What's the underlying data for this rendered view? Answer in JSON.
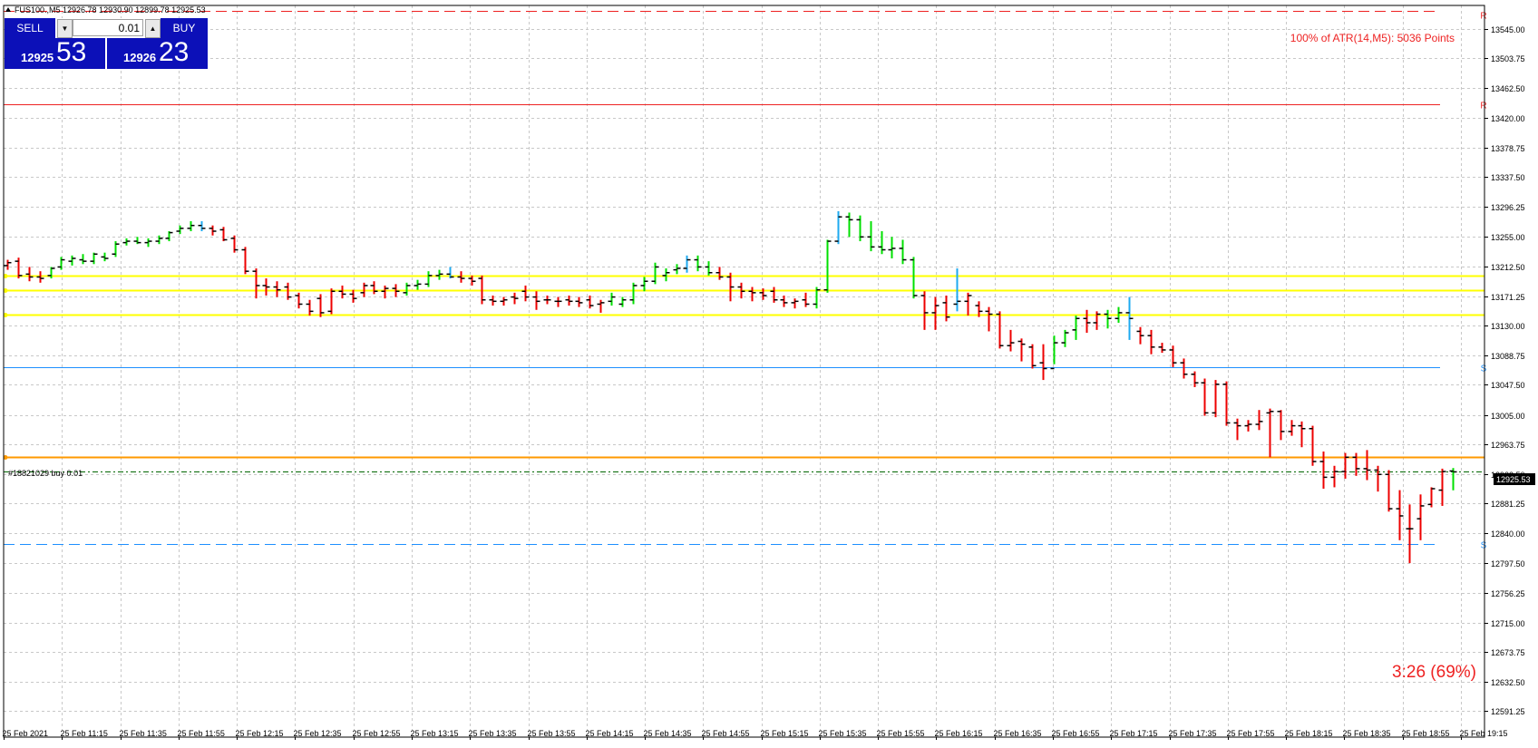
{
  "window": {
    "title": "FUS100.,M5  12926.78 12930.90 12899.78 12925.53",
    "symbol": "FUS100.",
    "timeframe": "M5",
    "ohlc": [
      "12926.78",
      "12930.90",
      "12899.78",
      "12925.53"
    ]
  },
  "trade_panel": {
    "sell_label": "SELL",
    "buy_label": "BUY",
    "lot_value": "0.01",
    "sell_price_small": "12925",
    "sell_price_big": "53",
    "buy_price_small": "12926",
    "buy_price_big": "23",
    "icons": [
      "arrow-down-icon",
      "arrow-up-icon"
    ]
  },
  "indicator_text": {
    "atr": "100% of ATR(14,M5): 5036  Points",
    "timer": "3:26 (69%)"
  },
  "order_label": "#18821029 buy 0.01",
  "current_price_label": "12925.53",
  "line_markers": {
    "resistance": "R",
    "support": "S"
  },
  "colors": {
    "bull": "#00e000",
    "bear": "#ee0000",
    "special": "#1eaaf0",
    "resistance": "#ee2222",
    "support": "#1e90ff",
    "zone": "#ffff00",
    "order": "#ff9900",
    "bid": "#006600",
    "text_red": "#ee2222",
    "grid": "#c8c8c8"
  },
  "chart_data": {
    "type": "ohlc-bar",
    "y_ticks": [
      "13545.00",
      "13503.75",
      "13462.50",
      "13420.00",
      "13378.75",
      "13337.50",
      "13296.25",
      "13255.00",
      "13212.50",
      "13171.25",
      "13130.00",
      "13088.75",
      "13047.50",
      "13005.00",
      "12963.75",
      "12922.50",
      "12881.25",
      "12840.00",
      "12797.50",
      "12756.25",
      "12715.00",
      "12673.75",
      "12632.50",
      "12591.25"
    ],
    "x_labels": [
      "25 Feb 2021",
      "25 Feb 11:15",
      "25 Feb 11:35",
      "25 Feb 11:55",
      "25 Feb 12:15",
      "25 Feb 12:35",
      "25 Feb 12:55",
      "25 Feb 13:15",
      "25 Feb 13:35",
      "25 Feb 13:55",
      "25 Feb 14:15",
      "25 Feb 14:35",
      "25 Feb 14:55",
      "25 Feb 15:15",
      "25 Feb 15:35",
      "25 Feb 15:55",
      "25 Feb 16:15",
      "25 Feb 16:35",
      "25 Feb 16:55",
      "25 Feb 17:15",
      "25 Feb 17:35",
      "25 Feb 17:55",
      "25 Feb 18:15",
      "25 Feb 18:35",
      "25 Feb 18:55",
      "25 Feb 19:15"
    ],
    "ylim": [
      12575,
      13570
    ],
    "levels": [
      {
        "kind": "resistance",
        "price": 13570,
        "style": "dashed"
      },
      {
        "kind": "resistance",
        "price": 13440,
        "style": "solid"
      },
      {
        "kind": "zone",
        "price": 13200,
        "style": "solid"
      },
      {
        "kind": "zone",
        "price": 13180,
        "style": "solid"
      },
      {
        "kind": "zone",
        "price": 13145,
        "style": "solid"
      },
      {
        "kind": "support",
        "price": 13072,
        "style": "solid"
      },
      {
        "kind": "order",
        "price": 12946,
        "style": "solid"
      },
      {
        "kind": "bid",
        "price": 12925.53,
        "style": "dashdot"
      },
      {
        "kind": "support",
        "price": 12825,
        "style": "dashed"
      }
    ],
    "bars": [
      {
        "o": 13214,
        "h": 13222,
        "l": 13208,
        "c": 13218,
        "d": "bear"
      },
      {
        "o": 13220,
        "h": 13225,
        "l": 13196,
        "c": 13200,
        "d": "bear"
      },
      {
        "o": 13202,
        "h": 13212,
        "l": 13192,
        "c": 13198,
        "d": "bear"
      },
      {
        "o": 13198,
        "h": 13206,
        "l": 13190,
        "c": 13196,
        "d": "bear"
      },
      {
        "o": 13200,
        "h": 13212,
        "l": 13196,
        "c": 13210,
        "d": "bull"
      },
      {
        "o": 13212,
        "h": 13226,
        "l": 13208,
        "c": 13222,
        "d": "bull"
      },
      {
        "o": 13220,
        "h": 13228,
        "l": 13214,
        "c": 13224,
        "d": "bull"
      },
      {
        "o": 13222,
        "h": 13230,
        "l": 13216,
        "c": 13220,
        "d": "bull"
      },
      {
        "o": 13220,
        "h": 13232,
        "l": 13216,
        "c": 13230,
        "d": "bull"
      },
      {
        "o": 13226,
        "h": 13232,
        "l": 13220,
        "c": 13224,
        "d": "bull"
      },
      {
        "o": 13230,
        "h": 13248,
        "l": 13226,
        "c": 13244,
        "d": "bull"
      },
      {
        "o": 13246,
        "h": 13252,
        "l": 13242,
        "c": 13248,
        "d": "bull"
      },
      {
        "o": 13248,
        "h": 13254,
        "l": 13244,
        "c": 13246,
        "d": "bull"
      },
      {
        "o": 13246,
        "h": 13252,
        "l": 13240,
        "c": 13248,
        "d": "bull"
      },
      {
        "o": 13248,
        "h": 13256,
        "l": 13244,
        "c": 13252,
        "d": "bull"
      },
      {
        "o": 13252,
        "h": 13262,
        "l": 13248,
        "c": 13260,
        "d": "bull"
      },
      {
        "o": 13262,
        "h": 13270,
        "l": 13258,
        "c": 13266,
        "d": "bull"
      },
      {
        "o": 13266,
        "h": 13276,
        "l": 13262,
        "c": 13270,
        "d": "bull"
      },
      {
        "o": 13270,
        "h": 13276,
        "l": 13262,
        "c": 13266,
        "d": "special"
      },
      {
        "o": 13266,
        "h": 13270,
        "l": 13256,
        "c": 13262,
        "d": "bear"
      },
      {
        "o": 13264,
        "h": 13268,
        "l": 13248,
        "c": 13250,
        "d": "bear"
      },
      {
        "o": 13252,
        "h": 13256,
        "l": 13232,
        "c": 13236,
        "d": "bear"
      },
      {
        "o": 13236,
        "h": 13240,
        "l": 13202,
        "c": 13206,
        "d": "bear"
      },
      {
        "o": 13206,
        "h": 13210,
        "l": 13168,
        "c": 13186,
        "d": "bear"
      },
      {
        "o": 13186,
        "h": 13196,
        "l": 13172,
        "c": 13184,
        "d": "bear"
      },
      {
        "o": 13184,
        "h": 13192,
        "l": 13170,
        "c": 13180,
        "d": "bear"
      },
      {
        "o": 13184,
        "h": 13190,
        "l": 13166,
        "c": 13170,
        "d": "bear"
      },
      {
        "o": 13172,
        "h": 13176,
        "l": 13154,
        "c": 13160,
        "d": "bear"
      },
      {
        "o": 13160,
        "h": 13166,
        "l": 13144,
        "c": 13150,
        "d": "bear"
      },
      {
        "o": 13168,
        "h": 13174,
        "l": 13142,
        "c": 13148,
        "d": "bear"
      },
      {
        "o": 13150,
        "h": 13182,
        "l": 13146,
        "c": 13178,
        "d": "bear"
      },
      {
        "o": 13178,
        "h": 13186,
        "l": 13168,
        "c": 13174,
        "d": "bear"
      },
      {
        "o": 13174,
        "h": 13180,
        "l": 13162,
        "c": 13168,
        "d": "bear"
      },
      {
        "o": 13176,
        "h": 13190,
        "l": 13170,
        "c": 13186,
        "d": "bear"
      },
      {
        "o": 13186,
        "h": 13192,
        "l": 13174,
        "c": 13178,
        "d": "bear"
      },
      {
        "o": 13178,
        "h": 13186,
        "l": 13168,
        "c": 13182,
        "d": "bear"
      },
      {
        "o": 13182,
        "h": 13188,
        "l": 13170,
        "c": 13178,
        "d": "bear"
      },
      {
        "o": 13176,
        "h": 13190,
        "l": 13172,
        "c": 13186,
        "d": "bull"
      },
      {
        "o": 13186,
        "h": 13194,
        "l": 13180,
        "c": 13188,
        "d": "bull"
      },
      {
        "o": 13188,
        "h": 13206,
        "l": 13184,
        "c": 13200,
        "d": "bull"
      },
      {
        "o": 13200,
        "h": 13208,
        "l": 13194,
        "c": 13202,
        "d": "bull"
      },
      {
        "o": 13202,
        "h": 13212,
        "l": 13196,
        "c": 13198,
        "d": "special"
      },
      {
        "o": 13198,
        "h": 13206,
        "l": 13190,
        "c": 13196,
        "d": "bear"
      },
      {
        "o": 13196,
        "h": 13200,
        "l": 13186,
        "c": 13192,
        "d": "bear"
      },
      {
        "o": 13196,
        "h": 13200,
        "l": 13160,
        "c": 13166,
        "d": "bear"
      },
      {
        "o": 13166,
        "h": 13172,
        "l": 13158,
        "c": 13164,
        "d": "bear"
      },
      {
        "o": 13164,
        "h": 13170,
        "l": 13158,
        "c": 13166,
        "d": "bear"
      },
      {
        "o": 13170,
        "h": 13176,
        "l": 13160,
        "c": 13168,
        "d": "bear"
      },
      {
        "o": 13178,
        "h": 13186,
        "l": 13164,
        "c": 13170,
        "d": "bear"
      },
      {
        "o": 13170,
        "h": 13178,
        "l": 13152,
        "c": 13164,
        "d": "bear"
      },
      {
        "o": 13166,
        "h": 13172,
        "l": 13160,
        "c": 13166,
        "d": "bear"
      },
      {
        "o": 13164,
        "h": 13170,
        "l": 13156,
        "c": 13164,
        "d": "bear"
      },
      {
        "o": 13166,
        "h": 13172,
        "l": 13158,
        "c": 13164,
        "d": "bear"
      },
      {
        "o": 13164,
        "h": 13170,
        "l": 13156,
        "c": 13162,
        "d": "bear"
      },
      {
        "o": 13166,
        "h": 13172,
        "l": 13154,
        "c": 13158,
        "d": "bear"
      },
      {
        "o": 13160,
        "h": 13166,
        "l": 13148,
        "c": 13162,
        "d": "bear"
      },
      {
        "o": 13164,
        "h": 13176,
        "l": 13158,
        "c": 13170,
        "d": "bull"
      },
      {
        "o": 13160,
        "h": 13170,
        "l": 13156,
        "c": 13166,
        "d": "bull"
      },
      {
        "o": 13166,
        "h": 13190,
        "l": 13160,
        "c": 13186,
        "d": "bull"
      },
      {
        "o": 13186,
        "h": 13198,
        "l": 13178,
        "c": 13192,
        "d": "bull"
      },
      {
        "o": 13192,
        "h": 13218,
        "l": 13188,
        "c": 13212,
        "d": "bull"
      },
      {
        "o": 13200,
        "h": 13210,
        "l": 13192,
        "c": 13204,
        "d": "bull"
      },
      {
        "o": 13208,
        "h": 13216,
        "l": 13202,
        "c": 13210,
        "d": "bull"
      },
      {
        "o": 13210,
        "h": 13228,
        "l": 13204,
        "c": 13222,
        "d": "special"
      },
      {
        "o": 13222,
        "h": 13228,
        "l": 13206,
        "c": 13212,
        "d": "bull"
      },
      {
        "o": 13212,
        "h": 13220,
        "l": 13200,
        "c": 13204,
        "d": "bull"
      },
      {
        "o": 13204,
        "h": 13212,
        "l": 13194,
        "c": 13198,
        "d": "bear"
      },
      {
        "o": 13198,
        "h": 13204,
        "l": 13164,
        "c": 13184,
        "d": "bear"
      },
      {
        "o": 13184,
        "h": 13190,
        "l": 13168,
        "c": 13178,
        "d": "bear"
      },
      {
        "o": 13178,
        "h": 13184,
        "l": 13164,
        "c": 13176,
        "d": "bear"
      },
      {
        "o": 13176,
        "h": 13182,
        "l": 13166,
        "c": 13172,
        "d": "bear"
      },
      {
        "o": 13178,
        "h": 13184,
        "l": 13162,
        "c": 13166,
        "d": "bear"
      },
      {
        "o": 13166,
        "h": 13172,
        "l": 13156,
        "c": 13162,
        "d": "bear"
      },
      {
        "o": 13162,
        "h": 13168,
        "l": 13154,
        "c": 13164,
        "d": "bear"
      },
      {
        "o": 13166,
        "h": 13176,
        "l": 13156,
        "c": 13160,
        "d": "bear"
      },
      {
        "o": 13160,
        "h": 13184,
        "l": 13154,
        "c": 13180,
        "d": "bull"
      },
      {
        "o": 13180,
        "h": 13250,
        "l": 13176,
        "c": 13248,
        "d": "bull"
      },
      {
        "o": 13248,
        "h": 13290,
        "l": 13244,
        "c": 13282,
        "d": "special"
      },
      {
        "o": 13282,
        "h": 13288,
        "l": 13254,
        "c": 13278,
        "d": "bull"
      },
      {
        "o": 13278,
        "h": 13284,
        "l": 13248,
        "c": 13254,
        "d": "bull"
      },
      {
        "o": 13254,
        "h": 13276,
        "l": 13234,
        "c": 13240,
        "d": "bull"
      },
      {
        "o": 13240,
        "h": 13262,
        "l": 13230,
        "c": 13236,
        "d": "bull"
      },
      {
        "o": 13236,
        "h": 13254,
        "l": 13224,
        "c": 13238,
        "d": "bull"
      },
      {
        "o": 13238,
        "h": 13250,
        "l": 13216,
        "c": 13222,
        "d": "bull"
      },
      {
        "o": 13222,
        "h": 13226,
        "l": 13168,
        "c": 13172,
        "d": "bull"
      },
      {
        "o": 13172,
        "h": 13178,
        "l": 13124,
        "c": 13148,
        "d": "bear"
      },
      {
        "o": 13148,
        "h": 13170,
        "l": 13124,
        "c": 13158,
        "d": "bear"
      },
      {
        "o": 13162,
        "h": 13172,
        "l": 13136,
        "c": 13142,
        "d": "bear"
      },
      {
        "o": 13160,
        "h": 13210,
        "l": 13150,
        "c": 13164,
        "d": "special"
      },
      {
        "o": 13164,
        "h": 13176,
        "l": 13144,
        "c": 13172,
        "d": "bear"
      },
      {
        "o": 13158,
        "h": 13164,
        "l": 13142,
        "c": 13150,
        "d": "bear"
      },
      {
        "o": 13150,
        "h": 13156,
        "l": 13122,
        "c": 13146,
        "d": "bear"
      },
      {
        "o": 13146,
        "h": 13150,
        "l": 13098,
        "c": 13102,
        "d": "bear"
      },
      {
        "o": 13102,
        "h": 13124,
        "l": 13094,
        "c": 13106,
        "d": "bear"
      },
      {
        "o": 13108,
        "h": 13112,
        "l": 13080,
        "c": 13104,
        "d": "bear"
      },
      {
        "o": 13100,
        "h": 13104,
        "l": 13070,
        "c": 13074,
        "d": "bear"
      },
      {
        "o": 13078,
        "h": 13104,
        "l": 13054,
        "c": 13070,
        "d": "bear"
      },
      {
        "o": 13070,
        "h": 13116,
        "l": 13076,
        "c": 13106,
        "d": "bull"
      },
      {
        "o": 13106,
        "h": 13124,
        "l": 13100,
        "c": 13120,
        "d": "bull"
      },
      {
        "o": 13124,
        "h": 13144,
        "l": 13110,
        "c": 13140,
        "d": "bull"
      },
      {
        "o": 13140,
        "h": 13152,
        "l": 13120,
        "c": 13134,
        "d": "bear"
      },
      {
        "o": 13134,
        "h": 13150,
        "l": 13124,
        "c": 13146,
        "d": "bear"
      },
      {
        "o": 13146,
        "h": 13152,
        "l": 13126,
        "c": 13140,
        "d": "bull"
      },
      {
        "o": 13140,
        "h": 13156,
        "l": 13134,
        "c": 13148,
        "d": "bull"
      },
      {
        "o": 13148,
        "h": 13170,
        "l": 13110,
        "c": 13140,
        "d": "special"
      },
      {
        "o": 13122,
        "h": 13128,
        "l": 13104,
        "c": 13116,
        "d": "bear"
      },
      {
        "o": 13116,
        "h": 13124,
        "l": 13090,
        "c": 13100,
        "d": "bear"
      },
      {
        "o": 13100,
        "h": 13106,
        "l": 13092,
        "c": 13096,
        "d": "bear"
      },
      {
        "o": 13096,
        "h": 13102,
        "l": 13072,
        "c": 13078,
        "d": "bear"
      },
      {
        "o": 13078,
        "h": 13084,
        "l": 13056,
        "c": 13062,
        "d": "bear"
      },
      {
        "o": 13062,
        "h": 13066,
        "l": 13044,
        "c": 13050,
        "d": "bear"
      },
      {
        "o": 13050,
        "h": 13056,
        "l": 13004,
        "c": 13008,
        "d": "bear"
      },
      {
        "o": 13008,
        "h": 13054,
        "l": 13002,
        "c": 13048,
        "d": "bear"
      },
      {
        "o": 13048,
        "h": 13052,
        "l": 12990,
        "c": 12994,
        "d": "bear"
      },
      {
        "o": 12994,
        "h": 13000,
        "l": 12970,
        "c": 12990,
        "d": "bear"
      },
      {
        "o": 12990,
        "h": 12998,
        "l": 12982,
        "c": 12992,
        "d": "bear"
      },
      {
        "o": 12992,
        "h": 13012,
        "l": 12984,
        "c": 12996,
        "d": "bear"
      },
      {
        "o": 13008,
        "h": 13014,
        "l": 12946,
        "c": 13010,
        "d": "bear"
      },
      {
        "o": 13010,
        "h": 13012,
        "l": 12970,
        "c": 12982,
        "d": "bear"
      },
      {
        "o": 12982,
        "h": 12998,
        "l": 12976,
        "c": 12990,
        "d": "bear"
      },
      {
        "o": 12990,
        "h": 12996,
        "l": 12960,
        "c": 12986,
        "d": "bear"
      },
      {
        "o": 12986,
        "h": 12990,
        "l": 12934,
        "c": 12940,
        "d": "bear"
      },
      {
        "o": 12940,
        "h": 12954,
        "l": 12902,
        "c": 12918,
        "d": "bear"
      },
      {
        "o": 12918,
        "h": 12934,
        "l": 12904,
        "c": 12926,
        "d": "bear"
      },
      {
        "o": 12926,
        "h": 12952,
        "l": 12916,
        "c": 12946,
        "d": "bear"
      },
      {
        "o": 12946,
        "h": 12952,
        "l": 12920,
        "c": 12930,
        "d": "bear"
      },
      {
        "o": 12930,
        "h": 12956,
        "l": 12914,
        "c": 12928,
        "d": "bear"
      },
      {
        "o": 12928,
        "h": 12934,
        "l": 12898,
        "c": 12922,
        "d": "bear"
      },
      {
        "o": 12922,
        "h": 12928,
        "l": 12870,
        "c": 12874,
        "d": "bear"
      },
      {
        "o": 12874,
        "h": 12900,
        "l": 12830,
        "c": 12864,
        "d": "bear"
      },
      {
        "o": 12846,
        "h": 12880,
        "l": 12798,
        "c": 12846,
        "d": "bear"
      },
      {
        "o": 12860,
        "h": 12894,
        "l": 12830,
        "c": 12878,
        "d": "bear"
      },
      {
        "o": 12880,
        "h": 12904,
        "l": 12876,
        "c": 12902,
        "d": "bear"
      },
      {
        "o": 12900,
        "h": 12930,
        "l": 12878,
        "c": 12926,
        "d": "bear"
      },
      {
        "o": 12926.78,
        "h": 12930.9,
        "l": 12899.78,
        "c": 12925.53,
        "d": "bull"
      }
    ]
  }
}
